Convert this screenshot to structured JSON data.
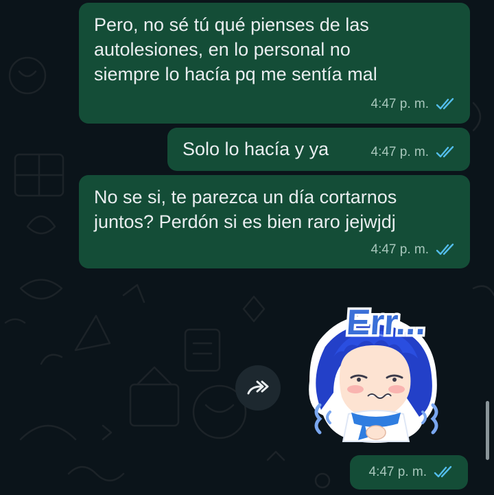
{
  "messages": [
    {
      "text": "Pero, no sé tú qué pienses de las\nautolesiones, en lo personal no\nsiempre lo hacía pq me sentía mal",
      "time": "4:47 p. m.",
      "status": "read"
    },
    {
      "text": "Solo lo hacía y ya",
      "time": "4:47 p. m.",
      "status": "read"
    },
    {
      "text": "No se si, te parezca un día cortarnos\njuntos? Perdón si es bien raro jejwjdj",
      "time": "4:47 p. m.",
      "status": "read"
    }
  ],
  "sticker": {
    "text": "Err...",
    "time": "4:47 p. m.",
    "status": "read"
  },
  "icons": {
    "forward": "forward-icon",
    "read_ticks": "double-check-icon"
  },
  "colors": {
    "background": "#0b141a",
    "bubble_outgoing": "#144d37",
    "text": "#e9edef",
    "meta_text": "#a8c7bc",
    "read_ticks": "#53bdeb",
    "sticker_hair": "#2340c8",
    "sticker_text": "#3a6fd8"
  }
}
